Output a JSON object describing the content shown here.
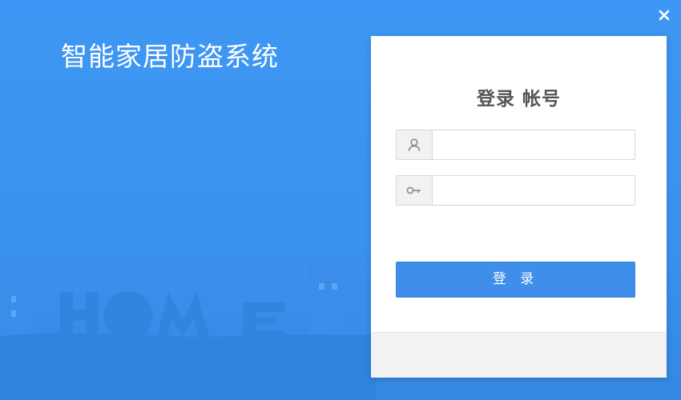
{
  "app": {
    "title": "智能家居防盗系统"
  },
  "window": {
    "close_label": "×"
  },
  "login": {
    "title": "登录 帐号",
    "username": {
      "value": "",
      "placeholder": "",
      "icon": "user-icon"
    },
    "password": {
      "value": "",
      "placeholder": "",
      "icon": "key-icon"
    },
    "submit_label": "登 录"
  },
  "background": {
    "word": "HOME"
  },
  "colors": {
    "background_blue": "#3b92ee",
    "button_blue": "#3e8eea",
    "card_white": "#ffffff",
    "title_gray": "#555555"
  }
}
